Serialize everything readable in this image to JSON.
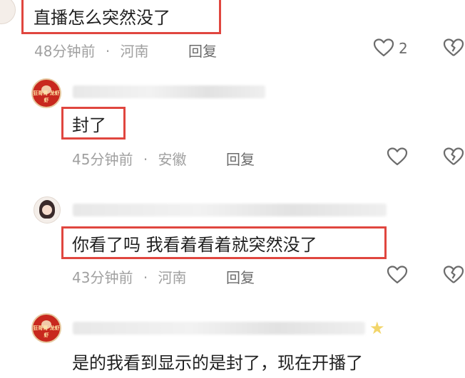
{
  "comments": [
    {
      "text": "直播怎么突然没了",
      "time": "48分钟前",
      "location": "河南",
      "reply_label": "回复",
      "like_count": "2"
    },
    {
      "text": "封了",
      "time": "45分钟前",
      "location": "安徽",
      "reply_label": "回复",
      "avatar_text": "狂哥哥 龙虾虾"
    },
    {
      "text": "你看了吗  我看着看着就突然没了",
      "time": "43分钟前",
      "location": "河南",
      "reply_label": "回复"
    },
    {
      "text": "是的我看到显示的是封了，现在开播了",
      "avatar_text": "狂哥哥 龙虾虾"
    }
  ],
  "separator": "·",
  "icons": {
    "like": "heart-outline-icon",
    "dislike": "broken-heart-icon",
    "badge": "star-icon"
  },
  "colors": {
    "highlight_border": "#e0463f",
    "meta_text": "#a0a0a0",
    "reply_text": "#6b6b6b"
  }
}
